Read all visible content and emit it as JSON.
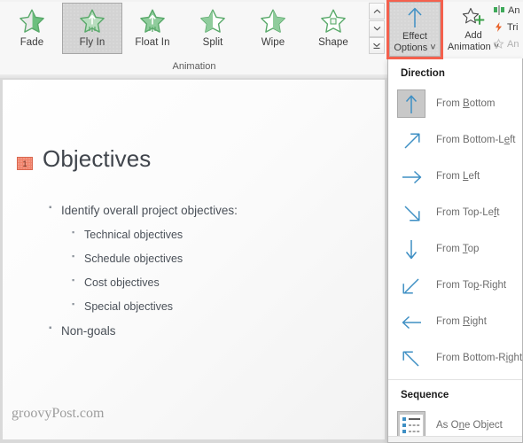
{
  "ribbon": {
    "group_label": "Animation",
    "gallery": [
      {
        "label": "Fade",
        "icon": "star-fade-icon",
        "selected": false
      },
      {
        "label": "Fly In",
        "icon": "star-fly-in-icon",
        "selected": true
      },
      {
        "label": "Float In",
        "icon": "star-float-in-icon",
        "selected": false
      },
      {
        "label": "Split",
        "icon": "star-split-icon",
        "selected": false
      },
      {
        "label": "Wipe",
        "icon": "star-wipe-icon",
        "selected": false
      },
      {
        "label": "Shape",
        "icon": "star-shape-icon",
        "selected": false
      }
    ],
    "gallery_scroll": {
      "up": "scroll-up-icon",
      "down": "scroll-down-icon",
      "more": "more-gallery-icon"
    },
    "effect_options": {
      "line1": "Effect",
      "line2": "Options",
      "chevron": "˅",
      "icon": "up-arrow-icon",
      "highlight_color": "#f4604d",
      "active": true
    },
    "add_animation": {
      "line1": "Add",
      "line2": "Animation",
      "chevron": "˅",
      "icon": "star-plus-icon"
    },
    "advanced": [
      {
        "label": "An",
        "icon": "animation-pane-icon",
        "color": "#3faa5a",
        "disabled": false
      },
      {
        "label": "Tri",
        "icon": "trigger-lightning-icon",
        "color": "#e8632a",
        "disabled": false
      },
      {
        "label": "An",
        "icon": "animation-painter-icon",
        "color": "#c0c0c0",
        "disabled": true
      }
    ]
  },
  "dropdown": {
    "direction_heading": "Direction",
    "sequence_heading": "Sequence",
    "directions": [
      {
        "label_pre": "From ",
        "key": "B",
        "label_post": "ottom",
        "icon": "arrow-up-icon",
        "selected": true
      },
      {
        "label_pre": "From Bottom-L",
        "key": "e",
        "label_post": "ft",
        "icon": "arrow-up-right-icon",
        "selected": false
      },
      {
        "label_pre": "From ",
        "key": "L",
        "label_post": "eft",
        "icon": "arrow-right-icon",
        "selected": false
      },
      {
        "label_pre": "From Top-Le",
        "key": "f",
        "label_post": "t",
        "icon": "arrow-down-right-icon",
        "selected": false
      },
      {
        "label_pre": "From ",
        "key": "T",
        "label_post": "op",
        "icon": "arrow-down-icon",
        "selected": false
      },
      {
        "label_pre": "From To",
        "key": "p",
        "label_post": "-Right",
        "icon": "arrow-down-left-icon",
        "selected": false
      },
      {
        "label_pre": "From ",
        "key": "R",
        "label_post": "ight",
        "icon": "arrow-left-icon",
        "selected": false
      },
      {
        "label_pre": "From Bottom-R",
        "key": "i",
        "label_post": "ght",
        "icon": "arrow-up-left-icon",
        "selected": false
      }
    ],
    "sequence": [
      {
        "label_pre": "As O",
        "key": "n",
        "label_post": "e Object",
        "icon": "as-one-object-icon",
        "selected": true
      }
    ]
  },
  "slide": {
    "animation_badge": "1",
    "title": "Objectives",
    "bullets": [
      {
        "level": 1,
        "text": "Identify overall project objectives:"
      },
      {
        "level": 2,
        "text": "Technical objectives"
      },
      {
        "level": 2,
        "text": "Schedule objectives"
      },
      {
        "level": 2,
        "text": "Cost objectives"
      },
      {
        "level": 2,
        "text": "Special objectives"
      },
      {
        "level": 1,
        "text": "Non-goals"
      }
    ],
    "watermark": "groovyPost.com"
  }
}
